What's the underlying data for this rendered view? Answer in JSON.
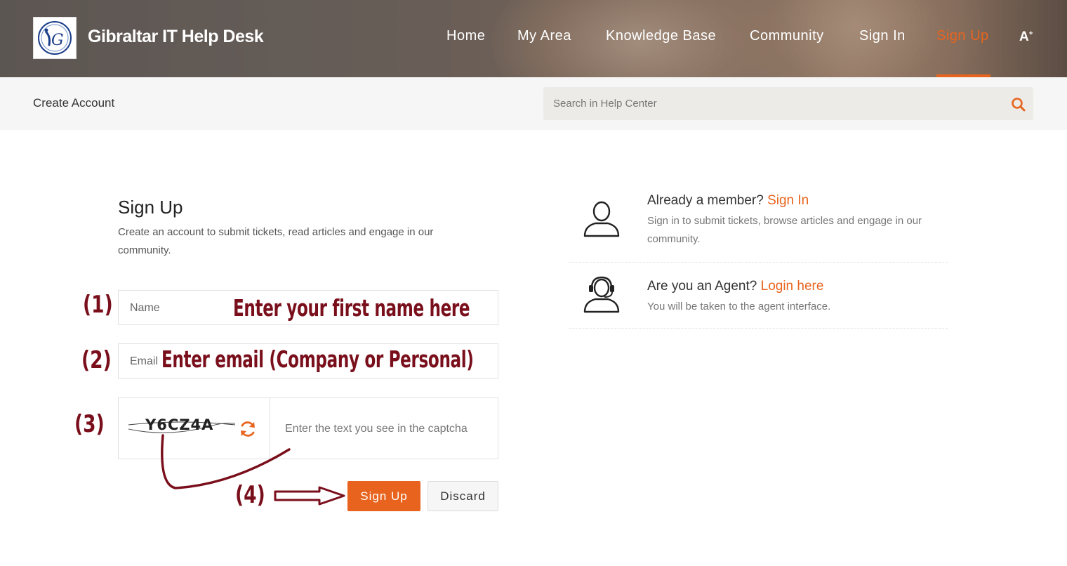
{
  "header": {
    "brand": "Gibraltar IT Help Desk",
    "logo_letters": "G",
    "nav": [
      "Home",
      "My Area",
      "Knowledge Base",
      "Community",
      "Sign In",
      "Sign Up"
    ],
    "active_nav": "Sign Up",
    "font_toggle": "A",
    "font_toggle_sup": "+"
  },
  "subbar": {
    "breadcrumb": "Create Account",
    "search_placeholder": "Search in Help Center"
  },
  "form": {
    "title": "Sign Up",
    "description": "Create an account to submit tickets, read articles and engage in our community.",
    "name_placeholder": "Name",
    "email_placeholder": "Email",
    "captcha_code": "Y6CZ4A",
    "captcha_placeholder": "Enter the text you see in the captcha",
    "signup_label": "Sign Up",
    "discard_label": "Discard"
  },
  "annotations": {
    "step1": "(1)",
    "step2": "(2)",
    "step3": "(3)",
    "step4": "(4)",
    "name_hint": "Enter your first name here",
    "email_hint": "Enter email (Company or Personal)"
  },
  "sidebar": {
    "member_title": "Already a member?",
    "member_link": "Sign In",
    "member_desc": "Sign in to submit tickets, browse articles and engage in our community.",
    "agent_title": "Are you an Agent?",
    "agent_link": "Login here",
    "agent_desc": "You will be taken to the agent interface."
  },
  "colors": {
    "accent": "#e8641e",
    "annotation": "#7a0f1c"
  }
}
